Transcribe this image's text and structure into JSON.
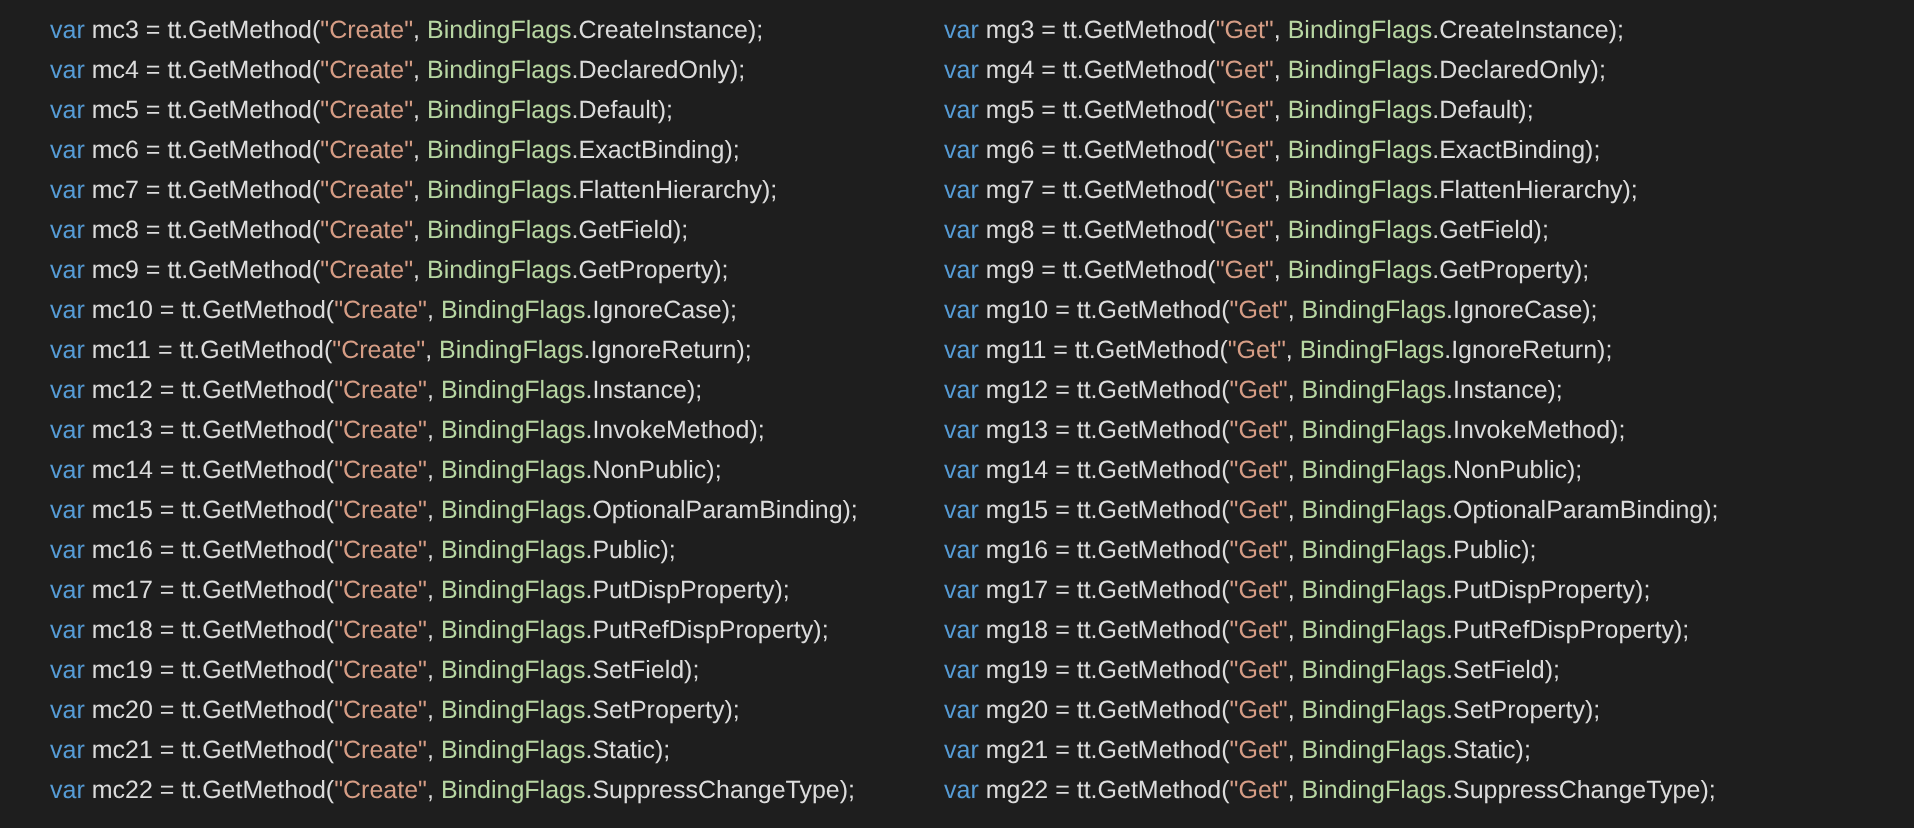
{
  "editor": {
    "columns": [
      {
        "lines": [
          {
            "tokens": [
              {
                "kind": "keyword",
                "text": "var"
              },
              {
                "kind": "plain",
                "text": " mc3 = tt.GetMethod("
              },
              {
                "kind": "string",
                "text": "\"Create\""
              },
              {
                "kind": "plain",
                "text": ", "
              },
              {
                "kind": "type",
                "text": "BindingFlags"
              },
              {
                "kind": "plain",
                "text": ".CreateInstance);"
              }
            ]
          },
          {
            "tokens": [
              {
                "kind": "keyword",
                "text": "var"
              },
              {
                "kind": "plain",
                "text": " mc4 = tt.GetMethod("
              },
              {
                "kind": "string",
                "text": "\"Create\""
              },
              {
                "kind": "plain",
                "text": ", "
              },
              {
                "kind": "type",
                "text": "BindingFlags"
              },
              {
                "kind": "plain",
                "text": ".DeclaredOnly);"
              }
            ]
          },
          {
            "tokens": [
              {
                "kind": "keyword",
                "text": "var"
              },
              {
                "kind": "plain",
                "text": " mc5 = tt.GetMethod("
              },
              {
                "kind": "string",
                "text": "\"Create\""
              },
              {
                "kind": "plain",
                "text": ", "
              },
              {
                "kind": "type",
                "text": "BindingFlags"
              },
              {
                "kind": "plain",
                "text": ".Default);"
              }
            ]
          },
          {
            "tokens": [
              {
                "kind": "keyword",
                "text": "var"
              },
              {
                "kind": "plain",
                "text": " mc6 = tt.GetMethod("
              },
              {
                "kind": "string",
                "text": "\"Create\""
              },
              {
                "kind": "plain",
                "text": ", "
              },
              {
                "kind": "type",
                "text": "BindingFlags"
              },
              {
                "kind": "plain",
                "text": ".ExactBinding);"
              }
            ]
          },
          {
            "tokens": [
              {
                "kind": "keyword",
                "text": "var"
              },
              {
                "kind": "plain",
                "text": " mc7 = tt.GetMethod("
              },
              {
                "kind": "string",
                "text": "\"Create\""
              },
              {
                "kind": "plain",
                "text": ", "
              },
              {
                "kind": "type",
                "text": "BindingFlags"
              },
              {
                "kind": "plain",
                "text": ".FlattenHierarchy);"
              }
            ]
          },
          {
            "tokens": [
              {
                "kind": "keyword",
                "text": "var"
              },
              {
                "kind": "plain",
                "text": " mc8 = tt.GetMethod("
              },
              {
                "kind": "string",
                "text": "\"Create\""
              },
              {
                "kind": "plain",
                "text": ", "
              },
              {
                "kind": "type",
                "text": "BindingFlags"
              },
              {
                "kind": "plain",
                "text": ".GetField);"
              }
            ]
          },
          {
            "tokens": [
              {
                "kind": "keyword",
                "text": "var"
              },
              {
                "kind": "plain",
                "text": " mc9 = tt.GetMethod("
              },
              {
                "kind": "string",
                "text": "\"Create\""
              },
              {
                "kind": "plain",
                "text": ", "
              },
              {
                "kind": "type",
                "text": "BindingFlags"
              },
              {
                "kind": "plain",
                "text": ".GetProperty);"
              }
            ]
          },
          {
            "tokens": [
              {
                "kind": "keyword",
                "text": "var"
              },
              {
                "kind": "plain",
                "text": " mc10 = tt.GetMethod("
              },
              {
                "kind": "string",
                "text": "\"Create\""
              },
              {
                "kind": "plain",
                "text": ", "
              },
              {
                "kind": "type",
                "text": "BindingFlags"
              },
              {
                "kind": "plain",
                "text": ".IgnoreCase);"
              }
            ]
          },
          {
            "tokens": [
              {
                "kind": "keyword",
                "text": "var"
              },
              {
                "kind": "plain",
                "text": " mc11 = tt.GetMethod("
              },
              {
                "kind": "string",
                "text": "\"Create\""
              },
              {
                "kind": "plain",
                "text": ", "
              },
              {
                "kind": "type",
                "text": "BindingFlags"
              },
              {
                "kind": "plain",
                "text": ".IgnoreReturn);"
              }
            ]
          },
          {
            "tokens": [
              {
                "kind": "keyword",
                "text": "var"
              },
              {
                "kind": "plain",
                "text": " mc12 = tt.GetMethod("
              },
              {
                "kind": "string",
                "text": "\"Create\""
              },
              {
                "kind": "plain",
                "text": ", "
              },
              {
                "kind": "type",
                "text": "BindingFlags"
              },
              {
                "kind": "plain",
                "text": ".Instance);"
              }
            ]
          },
          {
            "tokens": [
              {
                "kind": "keyword",
                "text": "var"
              },
              {
                "kind": "plain",
                "text": " mc13 = tt.GetMethod("
              },
              {
                "kind": "string",
                "text": "\"Create\""
              },
              {
                "kind": "plain",
                "text": ", "
              },
              {
                "kind": "type",
                "text": "BindingFlags"
              },
              {
                "kind": "plain",
                "text": ".InvokeMethod);"
              }
            ]
          },
          {
            "tokens": [
              {
                "kind": "keyword",
                "text": "var"
              },
              {
                "kind": "plain",
                "text": " mc14 = tt.GetMethod("
              },
              {
                "kind": "string",
                "text": "\"Create\""
              },
              {
                "kind": "plain",
                "text": ", "
              },
              {
                "kind": "type",
                "text": "BindingFlags"
              },
              {
                "kind": "plain",
                "text": ".NonPublic);"
              }
            ]
          },
          {
            "tokens": [
              {
                "kind": "keyword",
                "text": "var"
              },
              {
                "kind": "plain",
                "text": " mc15 = tt.GetMethod("
              },
              {
                "kind": "string",
                "text": "\"Create\""
              },
              {
                "kind": "plain",
                "text": ", "
              },
              {
                "kind": "type",
                "text": "BindingFlags"
              },
              {
                "kind": "plain",
                "text": ".OptionalParamBinding);"
              }
            ]
          },
          {
            "tokens": [
              {
                "kind": "keyword",
                "text": "var"
              },
              {
                "kind": "plain",
                "text": " mc16 = tt.GetMethod("
              },
              {
                "kind": "string",
                "text": "\"Create\""
              },
              {
                "kind": "plain",
                "text": ", "
              },
              {
                "kind": "type",
                "text": "BindingFlags"
              },
              {
                "kind": "plain",
                "text": ".Public);"
              }
            ]
          },
          {
            "tokens": [
              {
                "kind": "keyword",
                "text": "var"
              },
              {
                "kind": "plain",
                "text": " mc17 = tt.GetMethod("
              },
              {
                "kind": "string",
                "text": "\"Create\""
              },
              {
                "kind": "plain",
                "text": ", "
              },
              {
                "kind": "type",
                "text": "BindingFlags"
              },
              {
                "kind": "plain",
                "text": ".PutDispProperty);"
              }
            ]
          },
          {
            "tokens": [
              {
                "kind": "keyword",
                "text": "var"
              },
              {
                "kind": "plain",
                "text": " mc18 = tt.GetMethod("
              },
              {
                "kind": "string",
                "text": "\"Create\""
              },
              {
                "kind": "plain",
                "text": ", "
              },
              {
                "kind": "type",
                "text": "BindingFlags"
              },
              {
                "kind": "plain",
                "text": ".PutRefDispProperty);"
              }
            ]
          },
          {
            "tokens": [
              {
                "kind": "keyword",
                "text": "var"
              },
              {
                "kind": "plain",
                "text": " mc19 = tt.GetMethod("
              },
              {
                "kind": "string",
                "text": "\"Create\""
              },
              {
                "kind": "plain",
                "text": ", "
              },
              {
                "kind": "type",
                "text": "BindingFlags"
              },
              {
                "kind": "plain",
                "text": ".SetField);"
              }
            ]
          },
          {
            "tokens": [
              {
                "kind": "keyword",
                "text": "var"
              },
              {
                "kind": "plain",
                "text": " mc20 = tt.GetMethod("
              },
              {
                "kind": "string",
                "text": "\"Create\""
              },
              {
                "kind": "plain",
                "text": ", "
              },
              {
                "kind": "type",
                "text": "BindingFlags"
              },
              {
                "kind": "plain",
                "text": ".SetProperty);"
              }
            ]
          },
          {
            "tokens": [
              {
                "kind": "keyword",
                "text": "var"
              },
              {
                "kind": "plain",
                "text": " mc21 = tt.GetMethod("
              },
              {
                "kind": "string",
                "text": "\"Create\""
              },
              {
                "kind": "plain",
                "text": ", "
              },
              {
                "kind": "type",
                "text": "BindingFlags"
              },
              {
                "kind": "plain",
                "text": ".Static);"
              }
            ]
          },
          {
            "tokens": [
              {
                "kind": "keyword",
                "text": "var"
              },
              {
                "kind": "plain",
                "text": " mc22 = tt.GetMethod("
              },
              {
                "kind": "string",
                "text": "\"Create\""
              },
              {
                "kind": "plain",
                "text": ", "
              },
              {
                "kind": "type",
                "text": "BindingFlags"
              },
              {
                "kind": "plain",
                "text": ".SuppressChangeType);"
              }
            ]
          }
        ]
      },
      {
        "lines": [
          {
            "tokens": [
              {
                "kind": "keyword",
                "text": "var"
              },
              {
                "kind": "plain",
                "text": " mg3 = tt.GetMethod("
              },
              {
                "kind": "string",
                "text": "\"Get\""
              },
              {
                "kind": "plain",
                "text": ", "
              },
              {
                "kind": "type",
                "text": "BindingFlags"
              },
              {
                "kind": "plain",
                "text": ".CreateInstance);"
              }
            ]
          },
          {
            "tokens": [
              {
                "kind": "keyword",
                "text": "var"
              },
              {
                "kind": "plain",
                "text": " mg4 = tt.GetMethod("
              },
              {
                "kind": "string",
                "text": "\"Get\""
              },
              {
                "kind": "plain",
                "text": ", "
              },
              {
                "kind": "type",
                "text": "BindingFlags"
              },
              {
                "kind": "plain",
                "text": ".DeclaredOnly);"
              }
            ]
          },
          {
            "tokens": [
              {
                "kind": "keyword",
                "text": "var"
              },
              {
                "kind": "plain",
                "text": " mg5 = tt.GetMethod("
              },
              {
                "kind": "string",
                "text": "\"Get\""
              },
              {
                "kind": "plain",
                "text": ", "
              },
              {
                "kind": "type",
                "text": "BindingFlags"
              },
              {
                "kind": "plain",
                "text": ".Default);"
              }
            ]
          },
          {
            "tokens": [
              {
                "kind": "keyword",
                "text": "var"
              },
              {
                "kind": "plain",
                "text": " mg6 = tt.GetMethod("
              },
              {
                "kind": "string",
                "text": "\"Get\""
              },
              {
                "kind": "plain",
                "text": ", "
              },
              {
                "kind": "type",
                "text": "BindingFlags"
              },
              {
                "kind": "plain",
                "text": ".ExactBinding);"
              }
            ]
          },
          {
            "tokens": [
              {
                "kind": "keyword",
                "text": "var"
              },
              {
                "kind": "plain",
                "text": " mg7 = tt.GetMethod("
              },
              {
                "kind": "string",
                "text": "\"Get\""
              },
              {
                "kind": "plain",
                "text": ", "
              },
              {
                "kind": "type",
                "text": "BindingFlags"
              },
              {
                "kind": "plain",
                "text": ".FlattenHierarchy);"
              }
            ]
          },
          {
            "tokens": [
              {
                "kind": "keyword",
                "text": "var"
              },
              {
                "kind": "plain",
                "text": " mg8 = tt.GetMethod("
              },
              {
                "kind": "string",
                "text": "\"Get\""
              },
              {
                "kind": "plain",
                "text": ", "
              },
              {
                "kind": "type",
                "text": "BindingFlags"
              },
              {
                "kind": "plain",
                "text": ".GetField);"
              }
            ]
          },
          {
            "tokens": [
              {
                "kind": "keyword",
                "text": "var"
              },
              {
                "kind": "plain",
                "text": " mg9 = tt.GetMethod("
              },
              {
                "kind": "string",
                "text": "\"Get\""
              },
              {
                "kind": "plain",
                "text": ", "
              },
              {
                "kind": "type",
                "text": "BindingFlags"
              },
              {
                "kind": "plain",
                "text": ".GetProperty);"
              }
            ]
          },
          {
            "tokens": [
              {
                "kind": "keyword",
                "text": "var"
              },
              {
                "kind": "plain",
                "text": " mg10 = tt.GetMethod("
              },
              {
                "kind": "string",
                "text": "\"Get\""
              },
              {
                "kind": "plain",
                "text": ", "
              },
              {
                "kind": "type",
                "text": "BindingFlags"
              },
              {
                "kind": "plain",
                "text": ".IgnoreCase);"
              }
            ]
          },
          {
            "tokens": [
              {
                "kind": "keyword",
                "text": "var"
              },
              {
                "kind": "plain",
                "text": " mg11 = tt.GetMethod("
              },
              {
                "kind": "string",
                "text": "\"Get\""
              },
              {
                "kind": "plain",
                "text": ", "
              },
              {
                "kind": "type",
                "text": "BindingFlags"
              },
              {
                "kind": "plain",
                "text": ".IgnoreReturn);"
              }
            ]
          },
          {
            "tokens": [
              {
                "kind": "keyword",
                "text": "var"
              },
              {
                "kind": "plain",
                "text": " mg12 = tt.GetMethod("
              },
              {
                "kind": "string",
                "text": "\"Get\""
              },
              {
                "kind": "plain",
                "text": ", "
              },
              {
                "kind": "type",
                "text": "BindingFlags"
              },
              {
                "kind": "plain",
                "text": ".Instance);"
              }
            ]
          },
          {
            "tokens": [
              {
                "kind": "keyword",
                "text": "var"
              },
              {
                "kind": "plain",
                "text": " mg13 = tt.GetMethod("
              },
              {
                "kind": "string",
                "text": "\"Get\""
              },
              {
                "kind": "plain",
                "text": ", "
              },
              {
                "kind": "type",
                "text": "BindingFlags"
              },
              {
                "kind": "plain",
                "text": ".InvokeMethod);"
              }
            ]
          },
          {
            "tokens": [
              {
                "kind": "keyword",
                "text": "var"
              },
              {
                "kind": "plain",
                "text": " mg14 = tt.GetMethod("
              },
              {
                "kind": "string",
                "text": "\"Get\""
              },
              {
                "kind": "plain",
                "text": ", "
              },
              {
                "kind": "type",
                "text": "BindingFlags"
              },
              {
                "kind": "plain",
                "text": ".NonPublic);"
              }
            ]
          },
          {
            "tokens": [
              {
                "kind": "keyword",
                "text": "var"
              },
              {
                "kind": "plain",
                "text": " mg15 = tt.GetMethod("
              },
              {
                "kind": "string",
                "text": "\"Get\""
              },
              {
                "kind": "plain",
                "text": ", "
              },
              {
                "kind": "type",
                "text": "BindingFlags"
              },
              {
                "kind": "plain",
                "text": ".OptionalParamBinding);"
              }
            ]
          },
          {
            "tokens": [
              {
                "kind": "keyword",
                "text": "var"
              },
              {
                "kind": "plain",
                "text": " mg16 = tt.GetMethod("
              },
              {
                "kind": "string",
                "text": "\"Get\""
              },
              {
                "kind": "plain",
                "text": ", "
              },
              {
                "kind": "type",
                "text": "BindingFlags"
              },
              {
                "kind": "plain",
                "text": ".Public);"
              }
            ]
          },
          {
            "tokens": [
              {
                "kind": "keyword",
                "text": "var"
              },
              {
                "kind": "plain",
                "text": " mg17 = tt.GetMethod("
              },
              {
                "kind": "string",
                "text": "\"Get\""
              },
              {
                "kind": "plain",
                "text": ", "
              },
              {
                "kind": "type",
                "text": "BindingFlags"
              },
              {
                "kind": "plain",
                "text": ".PutDispProperty);"
              }
            ]
          },
          {
            "tokens": [
              {
                "kind": "keyword",
                "text": "var"
              },
              {
                "kind": "plain",
                "text": " mg18 = tt.GetMethod("
              },
              {
                "kind": "string",
                "text": "\"Get\""
              },
              {
                "kind": "plain",
                "text": ", "
              },
              {
                "kind": "type",
                "text": "BindingFlags"
              },
              {
                "kind": "plain",
                "text": ".PutRefDispProperty);"
              }
            ]
          },
          {
            "tokens": [
              {
                "kind": "keyword",
                "text": "var"
              },
              {
                "kind": "plain",
                "text": " mg19 = tt.GetMethod("
              },
              {
                "kind": "string",
                "text": "\"Get\""
              },
              {
                "kind": "plain",
                "text": ", "
              },
              {
                "kind": "type",
                "text": "BindingFlags"
              },
              {
                "kind": "plain",
                "text": ".SetField);"
              }
            ]
          },
          {
            "tokens": [
              {
                "kind": "keyword",
                "text": "var"
              },
              {
                "kind": "plain",
                "text": " mg20 = tt.GetMethod("
              },
              {
                "kind": "string",
                "text": "\"Get\""
              },
              {
                "kind": "plain",
                "text": ", "
              },
              {
                "kind": "type",
                "text": "BindingFlags"
              },
              {
                "kind": "plain",
                "text": ".SetProperty);"
              }
            ]
          },
          {
            "tokens": [
              {
                "kind": "keyword",
                "text": "var"
              },
              {
                "kind": "plain",
                "text": " mg21 = tt.GetMethod("
              },
              {
                "kind": "string",
                "text": "\"Get\""
              },
              {
                "kind": "plain",
                "text": ", "
              },
              {
                "kind": "type",
                "text": "BindingFlags"
              },
              {
                "kind": "plain",
                "text": ".Static);"
              }
            ]
          },
          {
            "tokens": [
              {
                "kind": "keyword",
                "text": "var"
              },
              {
                "kind": "plain",
                "text": " mg22 = tt.GetMethod("
              },
              {
                "kind": "string",
                "text": "\"Get\""
              },
              {
                "kind": "plain",
                "text": ", "
              },
              {
                "kind": "type",
                "text": "BindingFlags"
              },
              {
                "kind": "plain",
                "text": ".SuppressChangeType);"
              }
            ]
          }
        ]
      }
    ]
  }
}
